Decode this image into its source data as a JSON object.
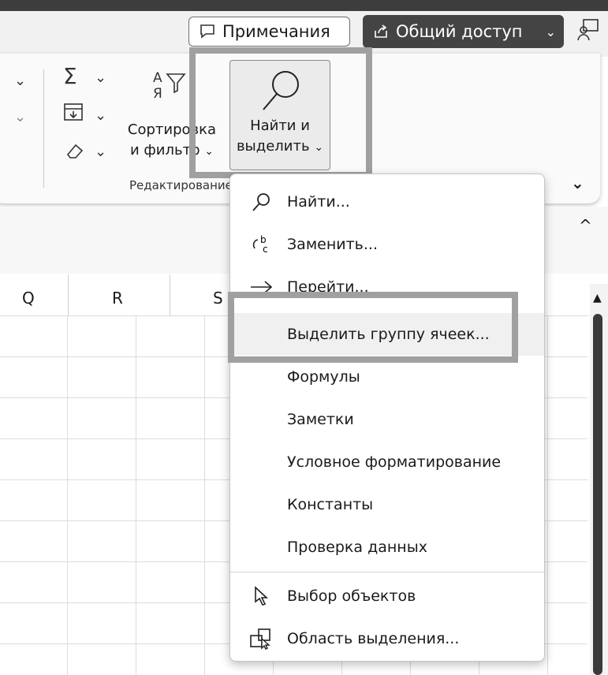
{
  "header": {
    "notes_label": "Примечания",
    "share_label": "Общий доступ"
  },
  "ribbon": {
    "sort_filter_line1": "Сортировка",
    "sort_filter_line2": "и фильтр",
    "find_select_line1": "Найти и",
    "find_select_line2": "выделить",
    "group_label": "Редактирование"
  },
  "columns": [
    "Q",
    "R",
    "S"
  ],
  "menu": {
    "items": [
      {
        "label": "Найти...",
        "icon": "search-icon"
      },
      {
        "label": "Заменить...",
        "icon": "replace-icon"
      },
      {
        "label": "Перейти...",
        "icon": "arrow-right-icon"
      },
      {
        "label": "Выделить группу ячеек...",
        "icon": ""
      },
      {
        "label": "Формулы",
        "icon": ""
      },
      {
        "label": "Заметки",
        "icon": ""
      },
      {
        "label": "Условное форматирование",
        "icon": ""
      },
      {
        "label": "Константы",
        "icon": ""
      },
      {
        "label": "Проверка данных",
        "icon": ""
      },
      {
        "label": "Выбор объектов",
        "icon": "pointer-icon"
      },
      {
        "label": "Область выделения...",
        "icon": "selection-pane-icon"
      }
    ]
  }
}
